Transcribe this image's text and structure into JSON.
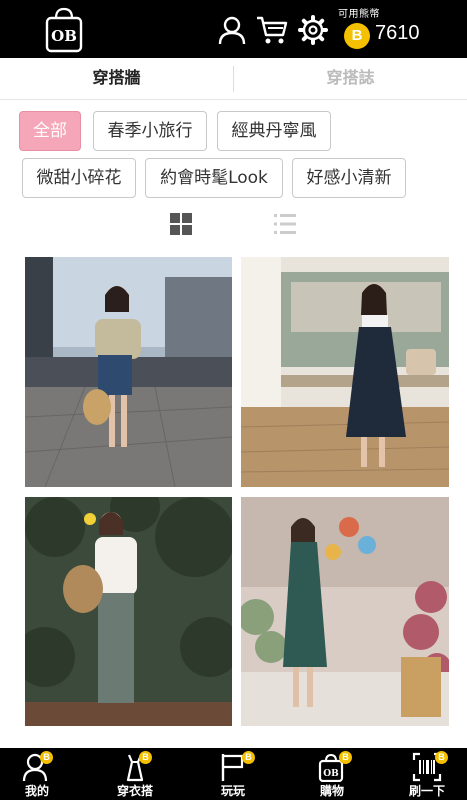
{
  "header": {
    "logo_text": "OB",
    "balance_label": "可用熊幣",
    "coin_symbol": "B",
    "balance": "7610",
    "icons": [
      "user-icon",
      "cart-icon",
      "gear-icon"
    ]
  },
  "tabs": [
    {
      "label": "穿搭牆",
      "active": true
    },
    {
      "label": "穿搭誌",
      "active": false
    }
  ],
  "filters": [
    {
      "label": "全部",
      "active": true
    },
    {
      "label": "春季小旅行",
      "active": false
    },
    {
      "label": "經典丹寧風",
      "active": false
    },
    {
      "label": "微甜小碎花",
      "active": false
    },
    {
      "label": "約會時髦Look",
      "active": false
    },
    {
      "label": "好感小清新",
      "active": false
    }
  ],
  "view_modes": {
    "grid": "grid-view-icon",
    "list": "list-view-icon",
    "selected": "grid"
  },
  "photos": [
    {
      "id": "outfit-1"
    },
    {
      "id": "outfit-2"
    },
    {
      "id": "outfit-3"
    },
    {
      "id": "outfit-4"
    }
  ],
  "bottom_nav": [
    {
      "label": "我的",
      "icon": "profile-icon",
      "badge": "B"
    },
    {
      "label": "穿衣搭",
      "icon": "dress-icon",
      "badge": "B"
    },
    {
      "label": "玩玩",
      "icon": "flag-icon",
      "badge": "B"
    },
    {
      "label": "購物",
      "icon": "shopping-bag-icon",
      "badge": "B"
    },
    {
      "label": "刷一下",
      "icon": "barcode-scan-icon",
      "badge": "B"
    }
  ],
  "colors": {
    "topbar": "#000000",
    "coin": "#f5c000",
    "active_chip": "#f5a6b8",
    "inactive_tab": "#bbbbbb"
  }
}
